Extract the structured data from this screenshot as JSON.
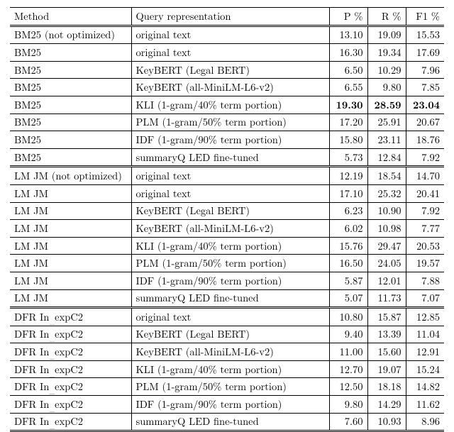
{
  "chart_data": {
    "type": "table",
    "columns": [
      "Method",
      "Query representation",
      "P %",
      "R %",
      "F1 %"
    ],
    "rows": [
      [
        "BM25 (not optimized)",
        "original text",
        13.1,
        19.09,
        15.53
      ],
      [
        "BM25",
        "original text",
        16.3,
        19.34,
        17.69
      ],
      [
        "BM25",
        "KeyBERT (Legal BERT)",
        6.5,
        10.29,
        7.96
      ],
      [
        "BM25",
        "KeyBERT (all-MiniLM-L6-v2)",
        6.55,
        9.8,
        7.85
      ],
      [
        "BM25",
        "KLI (1-gram/40% term portion)",
        19.3,
        28.59,
        23.04
      ],
      [
        "BM25",
        "PLM (1-gram/50% term portion)",
        17.2,
        25.91,
        20.67
      ],
      [
        "BM25",
        "IDF (1-gram/90% term portion)",
        15.8,
        23.11,
        18.76
      ],
      [
        "BM25",
        "summaryQ LED fine-tuned",
        5.73,
        12.84,
        7.92
      ],
      [
        "LM JM (not optimized)",
        "original text",
        12.19,
        18.54,
        14.7
      ],
      [
        "LM JM",
        "original text",
        17.1,
        25.32,
        20.41
      ],
      [
        "LM JM",
        "KeyBERT (Legal BERT)",
        6.23,
        10.9,
        7.92
      ],
      [
        "LM JM",
        "KeyBERT (all-MiniLM-L6-v2)",
        6.02,
        10.98,
        7.77
      ],
      [
        "LM JM",
        "KLI (1-gram/40% term portion)",
        15.76,
        29.47,
        20.53
      ],
      [
        "LM JM",
        "PLM (1-gram/50% term portion)",
        16.5,
        24.05,
        19.57
      ],
      [
        "LM JM",
        "IDF (1-gram/90% term portion)",
        5.87,
        12.01,
        7.88
      ],
      [
        "LM JM",
        "summaryQ LED fine-tuned",
        5.07,
        11.73,
        7.07
      ],
      [
        "DFR In_expC2",
        "original text",
        10.8,
        15.87,
        12.85
      ],
      [
        "DFR In_expC2",
        "KeyBERT (Legal BERT)",
        9.4,
        13.39,
        11.04
      ],
      [
        "DFR In_expC2",
        "KeyBERT (all-MiniLM-L6-v2)",
        11.0,
        15.6,
        12.91
      ],
      [
        "DFR In_expC2",
        "KLI (1-gram/40% term portion)",
        12.7,
        19.07,
        15.24
      ],
      [
        "DFR In_expC2",
        "PLM (1-gram/50% term portion)",
        12.5,
        18.18,
        14.82
      ],
      [
        "DFR In_expC2",
        "IDF (1-gram/90% term portion)",
        9.8,
        14.29,
        11.62
      ],
      [
        "DFR In_expC2",
        "summaryQ LED fine-tuned",
        7.6,
        10.93,
        8.96
      ]
    ]
  },
  "header": {
    "method": "Method",
    "qr": "Query representation",
    "p": "P %",
    "r": "R %",
    "f1": "F1 %"
  },
  "rows": [
    {
      "sep": "top",
      "bold": false,
      "method": "BM25 (not optimized)",
      "qr": "original text",
      "p": "13.10",
      "r": "19.09",
      "f1": "15.53"
    },
    {
      "sep": "thin",
      "bold": false,
      "method": "BM25",
      "qr": "original text",
      "p": "16.30",
      "r": "19.34",
      "f1": "17.69"
    },
    {
      "sep": "thin",
      "bold": false,
      "method": "BM25",
      "qr": "KeyBERT (Legal BERT)",
      "p": "6.50",
      "r": "10.29",
      "f1": "7.96"
    },
    {
      "sep": "thin",
      "bold": false,
      "method": "BM25",
      "qr": "KeyBERT (all-MiniLM-L6-v2)",
      "p": "6.55",
      "r": "9.80",
      "f1": "7.85"
    },
    {
      "sep": "thin",
      "bold": true,
      "method": "BM25",
      "qr": "KLI (1-gram/40% term portion)",
      "p": "19.30",
      "r": "28.59",
      "f1": "23.04"
    },
    {
      "sep": "thin",
      "bold": false,
      "method": "BM25",
      "qr": "PLM (1-gram/50% term portion)",
      "p": "17.20",
      "r": "25.91",
      "f1": "20.67"
    },
    {
      "sep": "thin",
      "bold": false,
      "method": "BM25",
      "qr": "IDF (1-gram/90% term portion)",
      "p": "15.80",
      "r": "23.11",
      "f1": "18.76"
    },
    {
      "sep": "thin",
      "bold": false,
      "method": "BM25",
      "qr": "summaryQ LED fine-tuned",
      "p": "5.73",
      "r": "12.84",
      "f1": "7.92"
    },
    {
      "sep": "dbl",
      "bold": false,
      "method": "LM JM (not optimized)",
      "qr": "original text",
      "p": "12.19",
      "r": "18.54",
      "f1": "14.70"
    },
    {
      "sep": "thin",
      "bold": false,
      "method": "LM JM",
      "qr": "original text",
      "p": "17.10",
      "r": "25.32",
      "f1": "20.41"
    },
    {
      "sep": "thin",
      "bold": false,
      "method": "LM JM",
      "qr": "KeyBERT (Legal BERT)",
      "p": "6.23",
      "r": "10.90",
      "f1": "7.92"
    },
    {
      "sep": "thin",
      "bold": false,
      "method": "LM JM",
      "qr": "KeyBERT (all-MiniLM-L6-v2)",
      "p": "6.02",
      "r": "10.98",
      "f1": "7.77"
    },
    {
      "sep": "thin",
      "bold": false,
      "method": "LM JM",
      "qr": "KLI (1-gram/40% term portion)",
      "p": "15.76",
      "r": "29.47",
      "f1": "20.53"
    },
    {
      "sep": "thin",
      "bold": false,
      "method": "LM JM",
      "qr": "PLM (1-gram/50% term portion)",
      "p": "16.50",
      "r": "24.05",
      "f1": "19.57"
    },
    {
      "sep": "thin",
      "bold": false,
      "method": "LM JM",
      "qr": "IDF (1-gram/90% term portion)",
      "p": "5.87",
      "r": "12.01",
      "f1": "7.88"
    },
    {
      "sep": "thin",
      "bold": false,
      "method": "LM JM",
      "qr": "summaryQ LED fine-tuned",
      "p": "5.07",
      "r": "11.73",
      "f1": "7.07"
    },
    {
      "sep": "dbl",
      "bold": false,
      "method": "DFR In_expC2",
      "qr": "original text",
      "p": "10.80",
      "r": "15.87",
      "f1": "12.85"
    },
    {
      "sep": "thin",
      "bold": false,
      "method": "DFR In_expC2",
      "qr": "KeyBERT (Legal BERT)",
      "p": "9.40",
      "r": "13.39",
      "f1": "11.04"
    },
    {
      "sep": "thin",
      "bold": false,
      "method": "DFR In_expC2",
      "qr": "KeyBERT (all-MiniLM-L6-v2)",
      "p": "11.00",
      "r": "15.60",
      "f1": "12.91"
    },
    {
      "sep": "thin",
      "bold": false,
      "method": "DFR In_expC2",
      "qr": "KLI (1-gram/40% term portion)",
      "p": "12.70",
      "r": "19.07",
      "f1": "15.24"
    },
    {
      "sep": "thin",
      "bold": false,
      "method": "DFR In_expC2",
      "qr": "PLM (1-gram/50% term portion)",
      "p": "12.50",
      "r": "18.18",
      "f1": "14.82"
    },
    {
      "sep": "thin",
      "bold": false,
      "method": "DFR In_expC2",
      "qr": "IDF (1-gram/90% term portion)",
      "p": "9.80",
      "r": "14.29",
      "f1": "11.62"
    },
    {
      "sep": "thin",
      "bold": false,
      "method": "DFR In_expC2",
      "qr": "summaryQ LED fine-tuned",
      "p": "7.60",
      "r": "10.93",
      "f1": "8.96"
    }
  ]
}
